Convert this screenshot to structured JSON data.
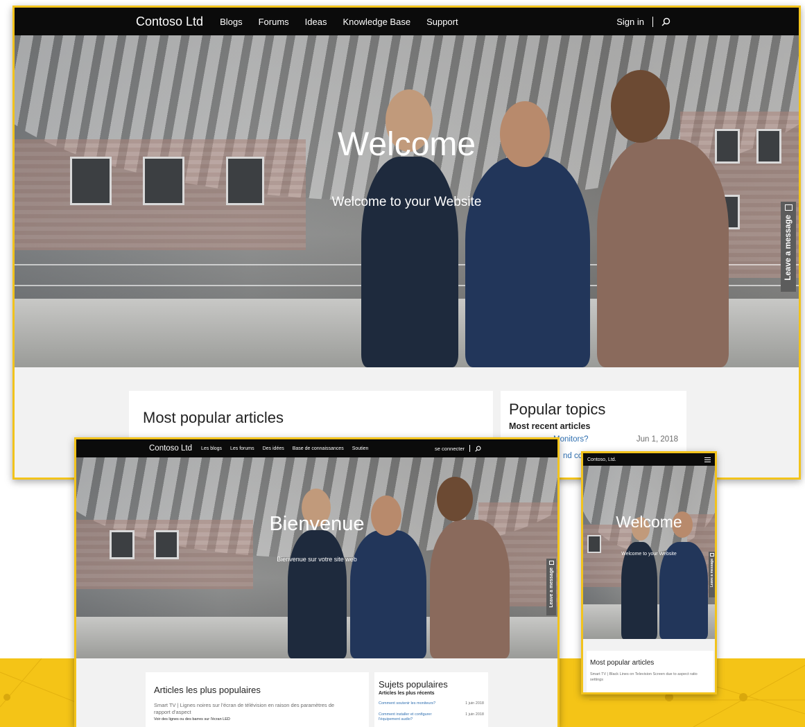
{
  "desktop_en": {
    "nav": {
      "brand": "Contoso Ltd",
      "links": [
        "Blogs",
        "Forums",
        "Ideas",
        "Knowledge Base",
        "Support"
      ],
      "sign_in": "Sign in"
    },
    "hero": {
      "title": "Welcome",
      "subtitle": "Welcome to your Website"
    },
    "leave_message": "Leave a message",
    "popular_articles": {
      "heading": "Most popular articles"
    },
    "popular_topics": {
      "heading": "Popular topics",
      "subheading": "Most recent articles",
      "items": [
        {
          "title": "Monitors?",
          "date": "Jun 1, 2018"
        },
        {
          "title": "nd con",
          "date": ""
        }
      ]
    }
  },
  "desktop_fr": {
    "nav": {
      "brand": "Contoso Ltd",
      "links": [
        "Les blogs",
        "Les forums",
        "Des idées",
        "Base de connaissances",
        "Soutien"
      ],
      "sign_in": "se connecter"
    },
    "hero": {
      "title": "Bienvenue",
      "subtitle": "Bienvenue sur votre site web"
    },
    "leave_message": "Leave a message",
    "popular_articles": {
      "heading": "Articles les plus populaires",
      "article_title": "Smart TV | Lignes noires sur l'écran de télévision en raison des paramètres de rapport d'aspect",
      "article_snippet": "Voir des lignes ou des barres sur l'écran LED"
    },
    "popular_topics": {
      "heading": "Sujets populaires",
      "subheading": "Articles les plus récents",
      "items": [
        {
          "title": "Comment soutenir les moniteurs?",
          "date": "1 juin 2018"
        },
        {
          "title": "Comment installer et configurer l'équipement audio?",
          "date": "1 juin 2018"
        }
      ]
    }
  },
  "mobile": {
    "nav": {
      "brand": "Contoso, Ltd."
    },
    "hero": {
      "title": "Welcome",
      "subtitle": "Welcome to your Website"
    },
    "leave_message": "Leave a message",
    "popular_articles": {
      "heading": "Most popular articles",
      "article_title": "Smart TV | Black Lines on Television Screen due to aspect ratio settings"
    }
  },
  "icons": {
    "search": "search-icon",
    "menu": "hamburger-menu-icon",
    "mail": "mail-icon"
  },
  "colors": {
    "accent_yellow": "#f2c31c",
    "nav_black": "#0b0b0b",
    "link_blue": "#2f6fb0",
    "leave_tab": "#5c5c5c"
  }
}
